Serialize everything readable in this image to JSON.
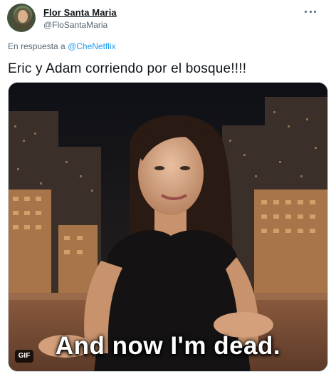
{
  "author": {
    "name": "Flor Santa Maria",
    "handle": "@FloSantaMaria"
  },
  "reply": {
    "prefix": "En respuesta a",
    "mention": "@CheNetflix"
  },
  "tweet": {
    "text": "Eric y Adam corriendo por el bosque!!!!"
  },
  "media": {
    "caption": "And now I'm dead.",
    "badge": "GIF"
  },
  "colors": {
    "link": "#1d9bf0",
    "secondary_text": "#536471",
    "primary_text": "#0f1419"
  },
  "icons": {
    "more": "more-horizontal-icon"
  }
}
